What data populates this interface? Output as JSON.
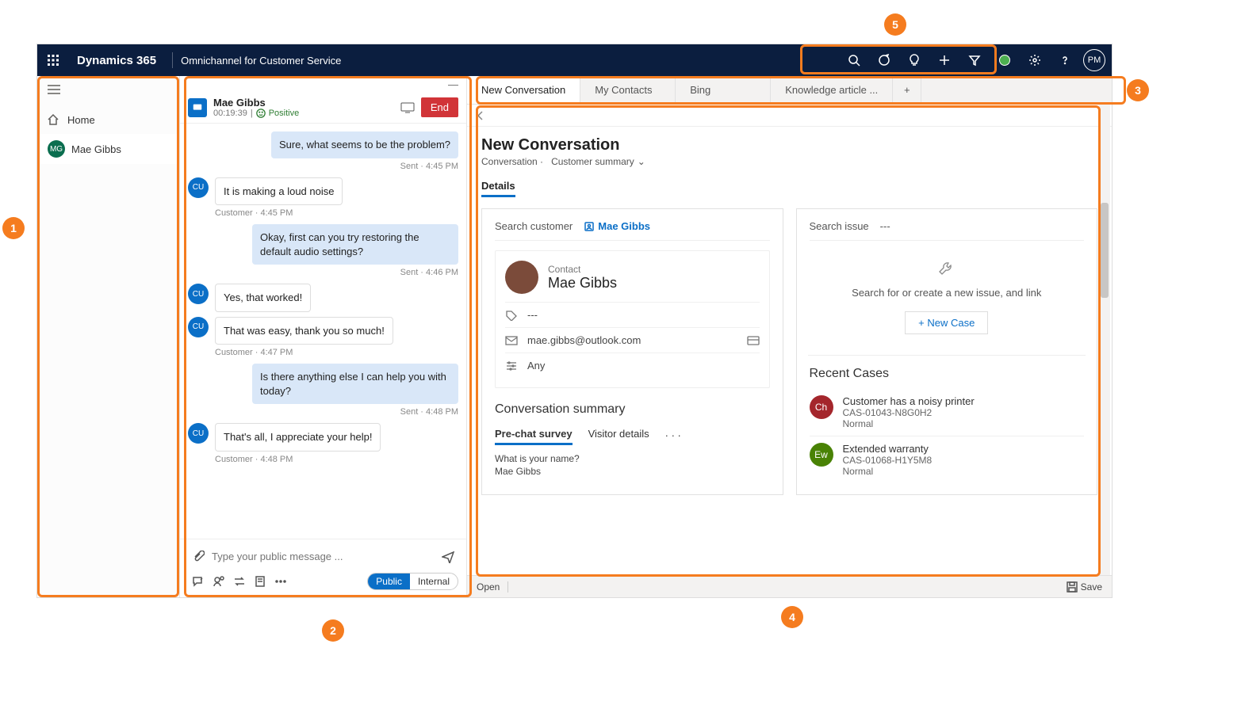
{
  "header": {
    "brand": "Dynamics 365",
    "appname": "Omnichannel for Customer Service",
    "user_initials": "PM"
  },
  "sidebar": {
    "home": "Home",
    "session": {
      "initials": "MG",
      "name": "Mae Gibbs"
    }
  },
  "conv": {
    "name": "Mae Gibbs",
    "duration": "00:19:39",
    "sentiment": "Positive",
    "end": "End",
    "cu": "CU",
    "messages": {
      "m0": {
        "text": "Sure, what seems to be the problem?",
        "ts": "Sent · 4:45 PM"
      },
      "m1": {
        "text": "It is making a loud noise",
        "ts": "Customer · 4:45 PM"
      },
      "m2": {
        "text": "Okay, first can you try restoring the default audio settings?",
        "ts": "Sent · 4:46 PM"
      },
      "m3": {
        "text": "Yes, that worked!"
      },
      "m4": {
        "text": "That was easy, thank you so much!",
        "ts": "Customer · 4:47 PM"
      },
      "m5": {
        "text": "Is there anything else I can help you with today?",
        "ts": "Sent · 4:48 PM"
      },
      "m6": {
        "text": "That's all, I appreciate your help!",
        "ts": "Customer · 4:48 PM"
      }
    },
    "compose_placeholder": "Type your public message ...",
    "pill_public": "Public",
    "pill_internal": "Internal"
  },
  "tabs": {
    "t0": "New Conversation",
    "t1": "My Contacts",
    "t2": "Bing",
    "t3": "Knowledge article ..."
  },
  "page": {
    "title": "New Conversation",
    "crumb1": "Conversation",
    "crumb2": "Customer summary",
    "details": "Details",
    "search_customer": "Search customer",
    "customer_link": "Mae Gibbs",
    "contact_label": "Contact",
    "contact_name": "Mae Gibbs",
    "field_company": "---",
    "field_email": "mae.gibbs@outlook.com",
    "field_pref": "Any",
    "search_issue": "Search issue",
    "issue_dash": "---",
    "issue_hint": "Search for or create a new issue, and link",
    "new_case": "+ New Case",
    "recent_title": "Recent Cases",
    "cases": {
      "c0": {
        "icon": "Ch",
        "title": "Customer has a noisy printer",
        "num": "CAS-01043-N8G0H2",
        "pri": "Normal"
      },
      "c1": {
        "icon": "Ew",
        "title": "Extended warranty",
        "num": "CAS-01068-H1Y5M8",
        "pri": "Normal"
      }
    },
    "summary_title": "Conversation summary",
    "summary_tab1": "Pre-chat survey",
    "summary_tab2": "Visitor details",
    "qa_q": "What is your name?",
    "qa_a": "Mae Gibbs"
  },
  "footer": {
    "open": "Open",
    "save": "Save"
  },
  "callouts": {
    "c1": "1",
    "c2": "2",
    "c3": "3",
    "c4": "4",
    "c5": "5"
  }
}
